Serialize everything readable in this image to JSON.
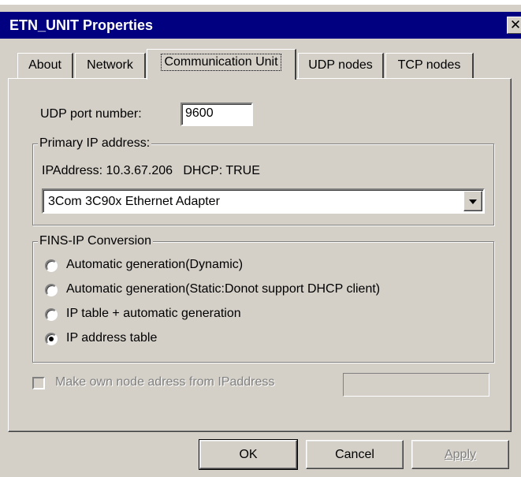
{
  "window": {
    "title": "ETN_UNIT Properties",
    "close_glyph": "✕"
  },
  "tabs": [
    {
      "label": "About"
    },
    {
      "label": "Network"
    },
    {
      "label": "Communication Unit"
    },
    {
      "label": "UDP nodes"
    },
    {
      "label": "TCP nodes"
    }
  ],
  "active_tab": "Communication Unit",
  "udp_port": {
    "label": "UDP port number:",
    "value": "9600"
  },
  "primary_ip": {
    "group_title": "Primary IP address:",
    "info": "IPAddress: 10.3.67.206   DHCP: TRUE",
    "adapter": "3Com 3C90x Ethernet Adapter"
  },
  "fins_ip": {
    "group_title": "FINS-IP Conversion",
    "options": [
      {
        "label": "Automatic generation(Dynamic)",
        "selected": false
      },
      {
        "label": "Automatic generation(Static:Donot support DHCP client)",
        "selected": false
      },
      {
        "label": "IP table + automatic generation",
        "selected": false
      },
      {
        "label": "IP address table",
        "selected": true
      }
    ]
  },
  "own_node": {
    "label": "Make own node adress from IPaddress",
    "checked": false,
    "enabled": false,
    "value": ""
  },
  "buttons": {
    "ok": "OK",
    "cancel": "Cancel",
    "apply": "Apply"
  },
  "colors": {
    "face": "#d4d0c8",
    "title_bar": "#000080",
    "disabled_text": "#808080"
  }
}
